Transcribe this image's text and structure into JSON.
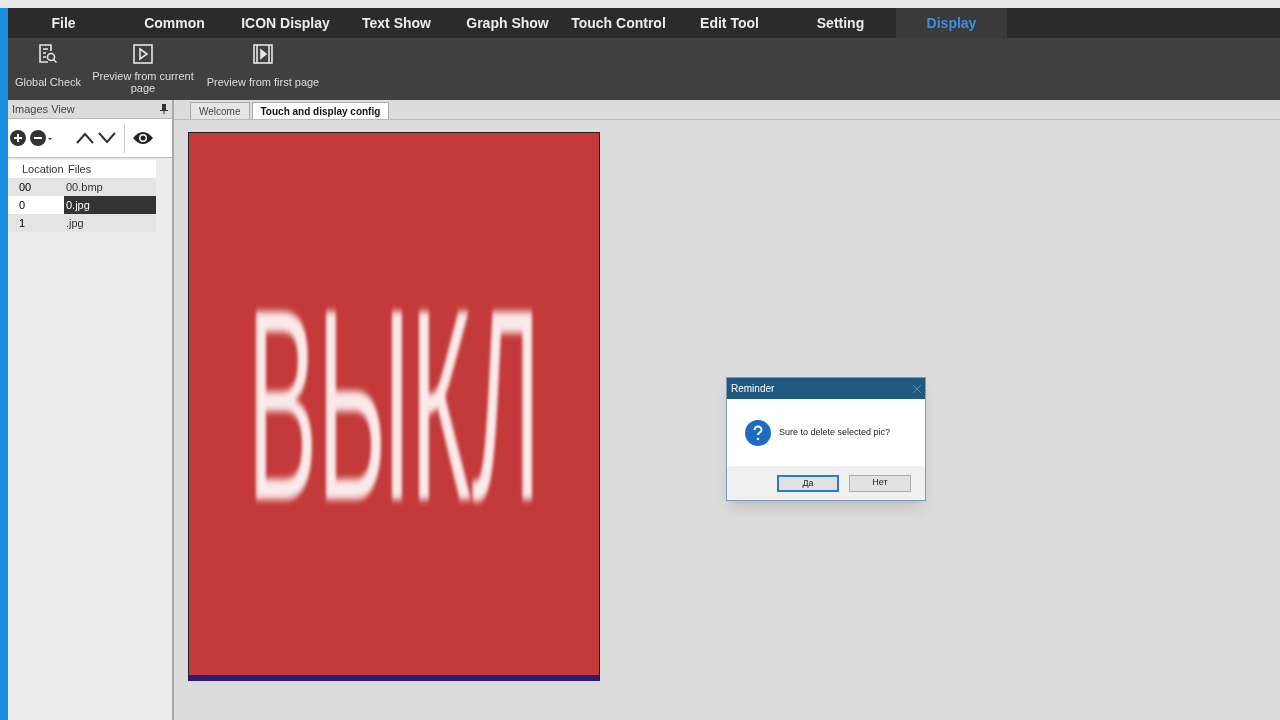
{
  "menu": [
    {
      "label": "File",
      "selected": false
    },
    {
      "label": "Common",
      "selected": false
    },
    {
      "label": "ICON Display",
      "selected": false
    },
    {
      "label": "Text Show",
      "selected": false
    },
    {
      "label": "Graph Show",
      "selected": false
    },
    {
      "label": "Touch Control",
      "selected": false
    },
    {
      "label": "Edit Tool",
      "selected": false
    },
    {
      "label": "Setting",
      "selected": false
    },
    {
      "label": "Display",
      "selected": true
    }
  ],
  "toolbar": [
    {
      "kind": "check",
      "label": "Global Check"
    },
    {
      "kind": "play",
      "label": "Preview from current page"
    },
    {
      "kind": "film",
      "label": "Preview from first page"
    }
  ],
  "images_view": {
    "title": "Images View",
    "columns": [
      "Location",
      "Files"
    ],
    "rows": [
      {
        "location": "00",
        "file": "00.bmp",
        "selected": false
      },
      {
        "location": "0",
        "file": "0.jpg",
        "selected": true
      },
      {
        "location": "1",
        "file": ".jpg",
        "selected": false
      }
    ]
  },
  "tabs": [
    {
      "label": "Welcome",
      "selected": false
    },
    {
      "label": "Touch and display config",
      "selected": true
    }
  ],
  "preview": {
    "text": "ВЫКЛ"
  },
  "dialog": {
    "title": "Reminder",
    "message": "Sure to delete selected pic?",
    "buttons": [
      {
        "label": "Да",
        "selected": true
      },
      {
        "label": "Нет",
        "selected": false
      }
    ]
  }
}
